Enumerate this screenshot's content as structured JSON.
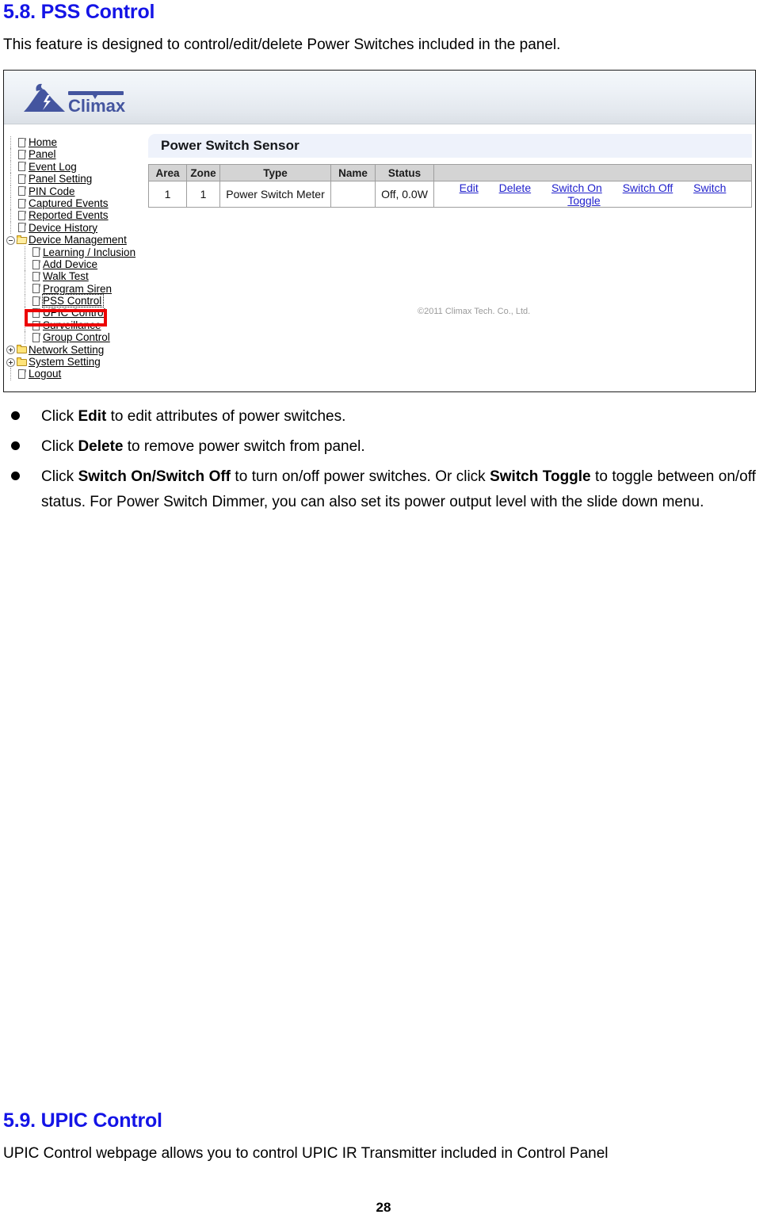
{
  "document": {
    "section_58_heading": "5.8. PSS Control",
    "section_58_intro": "This feature is designed to control/edit/delete Power Switches included in the panel.",
    "section_59_heading": "5.9. UPIC Control",
    "section_59_intro": "UPIC Control webpage allows you to control UPIC IR Transmitter included in Control Panel",
    "page_number": "28"
  },
  "bullets": [
    {
      "prefix": "Click ",
      "bold1": "Edit",
      "middle": " to edit attributes of power switches.",
      "bold2": "",
      "suffix": ""
    },
    {
      "prefix": "Click ",
      "bold1": "Delete",
      "middle": " to remove power switch from panel.",
      "bold2": "",
      "suffix": ""
    },
    {
      "prefix": "Click ",
      "bold1": "Switch On/Switch Off",
      "middle": " to turn on/off power switches. Or click ",
      "bold2": "Switch Toggle",
      "suffix": " to toggle between on/off status. For Power Switch Dimmer, you can also set its power output level with the slide down menu."
    }
  ],
  "screenshot": {
    "logo": {
      "brand": "Climax",
      "icon": "mountain-lightning-logo",
      "color": "#44559f"
    },
    "sidebar": {
      "items": [
        {
          "label": "Home",
          "icon": "page-icon",
          "level": 1,
          "toggle": "none",
          "focused": false
        },
        {
          "label": "Panel",
          "icon": "page-icon",
          "level": 1,
          "toggle": "none",
          "focused": false
        },
        {
          "label": "Event Log",
          "icon": "page-icon",
          "level": 1,
          "toggle": "none",
          "focused": false
        },
        {
          "label": "Panel Setting",
          "icon": "page-icon",
          "level": 1,
          "toggle": "none",
          "focused": false
        },
        {
          "label": "PIN Code",
          "icon": "page-icon",
          "level": 1,
          "toggle": "none",
          "focused": false
        },
        {
          "label": "Captured Events",
          "icon": "page-icon",
          "level": 1,
          "toggle": "none",
          "focused": false
        },
        {
          "label": "Reported Events",
          "icon": "page-icon",
          "level": 1,
          "toggle": "none",
          "focused": false
        },
        {
          "label": "Device History",
          "icon": "page-icon",
          "level": 1,
          "toggle": "none",
          "focused": false
        },
        {
          "label": "Device Management",
          "icon": "folder-open-icon",
          "level": 1,
          "toggle": "minus",
          "focused": false
        },
        {
          "label": "Learning / Inclusion",
          "icon": "page-icon",
          "level": 2,
          "toggle": "none",
          "focused": false
        },
        {
          "label": "Add Device",
          "icon": "page-icon",
          "level": 2,
          "toggle": "none",
          "focused": false
        },
        {
          "label": "Walk Test",
          "icon": "page-icon",
          "level": 2,
          "toggle": "none",
          "focused": false
        },
        {
          "label": "Program Siren",
          "icon": "page-icon",
          "level": 2,
          "toggle": "none",
          "focused": false
        },
        {
          "label": "PSS Control",
          "icon": "page-icon",
          "level": 2,
          "toggle": "none",
          "focused": true
        },
        {
          "label": "UPIC Control",
          "icon": "page-icon",
          "level": 2,
          "toggle": "none",
          "focused": false
        },
        {
          "label": "Surveillance",
          "icon": "page-icon",
          "level": 2,
          "toggle": "none",
          "focused": false
        },
        {
          "label": "Group Control",
          "icon": "page-icon",
          "level": 2,
          "toggle": "none",
          "focused": false
        },
        {
          "label": "Network Setting",
          "icon": "folder-icon",
          "level": 1,
          "toggle": "plus",
          "focused": false
        },
        {
          "label": "System Setting",
          "icon": "folder-icon",
          "level": 1,
          "toggle": "plus",
          "focused": false
        },
        {
          "label": "Logout",
          "icon": "page-icon",
          "level": 1,
          "toggle": "none",
          "focused": false
        }
      ],
      "annotation_color": "#ec0404"
    },
    "panel": {
      "title": "Power Switch Sensor",
      "table": {
        "columns": [
          "Area",
          "Zone",
          "Type",
          "Name",
          "Status",
          ""
        ],
        "rows": [
          {
            "area": "1",
            "zone": "1",
            "type": "Power Switch Meter",
            "name": "",
            "status": "Off, 0.0W",
            "actions": [
              "Edit",
              "Delete",
              "Switch On",
              "Switch Off",
              "Switch Toggle"
            ]
          }
        ]
      },
      "copyright": "©2011 Climax Tech. Co., Ltd."
    }
  }
}
